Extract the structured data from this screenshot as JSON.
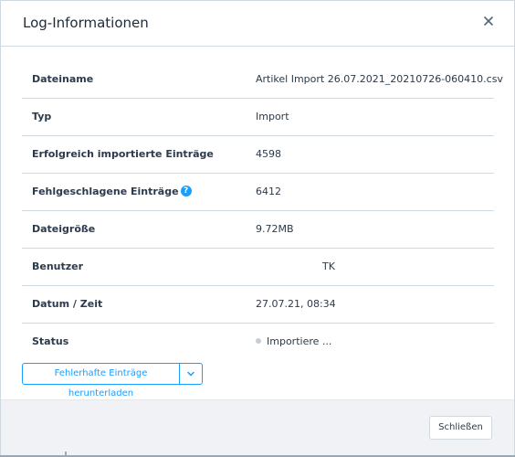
{
  "modal": {
    "title": "Log-Informationen"
  },
  "rows": [
    {
      "label": "Dateiname",
      "value": "Artikel Import 26.07.2021_20210726-060410.csv"
    },
    {
      "label": "Typ",
      "value": "Import"
    },
    {
      "label": "Erfolgreich importierte Einträge",
      "value": "4598"
    },
    {
      "label": "Fehlgeschlagene Einträge",
      "value": "6412",
      "help": "?"
    },
    {
      "label": "Dateigröße",
      "value": "9.72MB"
    },
    {
      "label": "Benutzer",
      "value": "TK"
    },
    {
      "label": "Datum / Zeit",
      "value": "27.07.21, 08:34"
    },
    {
      "label": "Status",
      "value": "Importiere ..."
    }
  ],
  "actions": {
    "download_label": "Fehlerhafte Einträge herunterladen",
    "close_label": "Schließen"
  },
  "icons": {
    "close": "close-icon",
    "help": "help-icon",
    "dropdown": "chevron-down-icon",
    "status": "status-dot-icon"
  },
  "colors": {
    "accent": "#189eff",
    "text": "#2c3a4b",
    "border": "#d1d9e0",
    "footer_bg": "#f0f2f5"
  }
}
